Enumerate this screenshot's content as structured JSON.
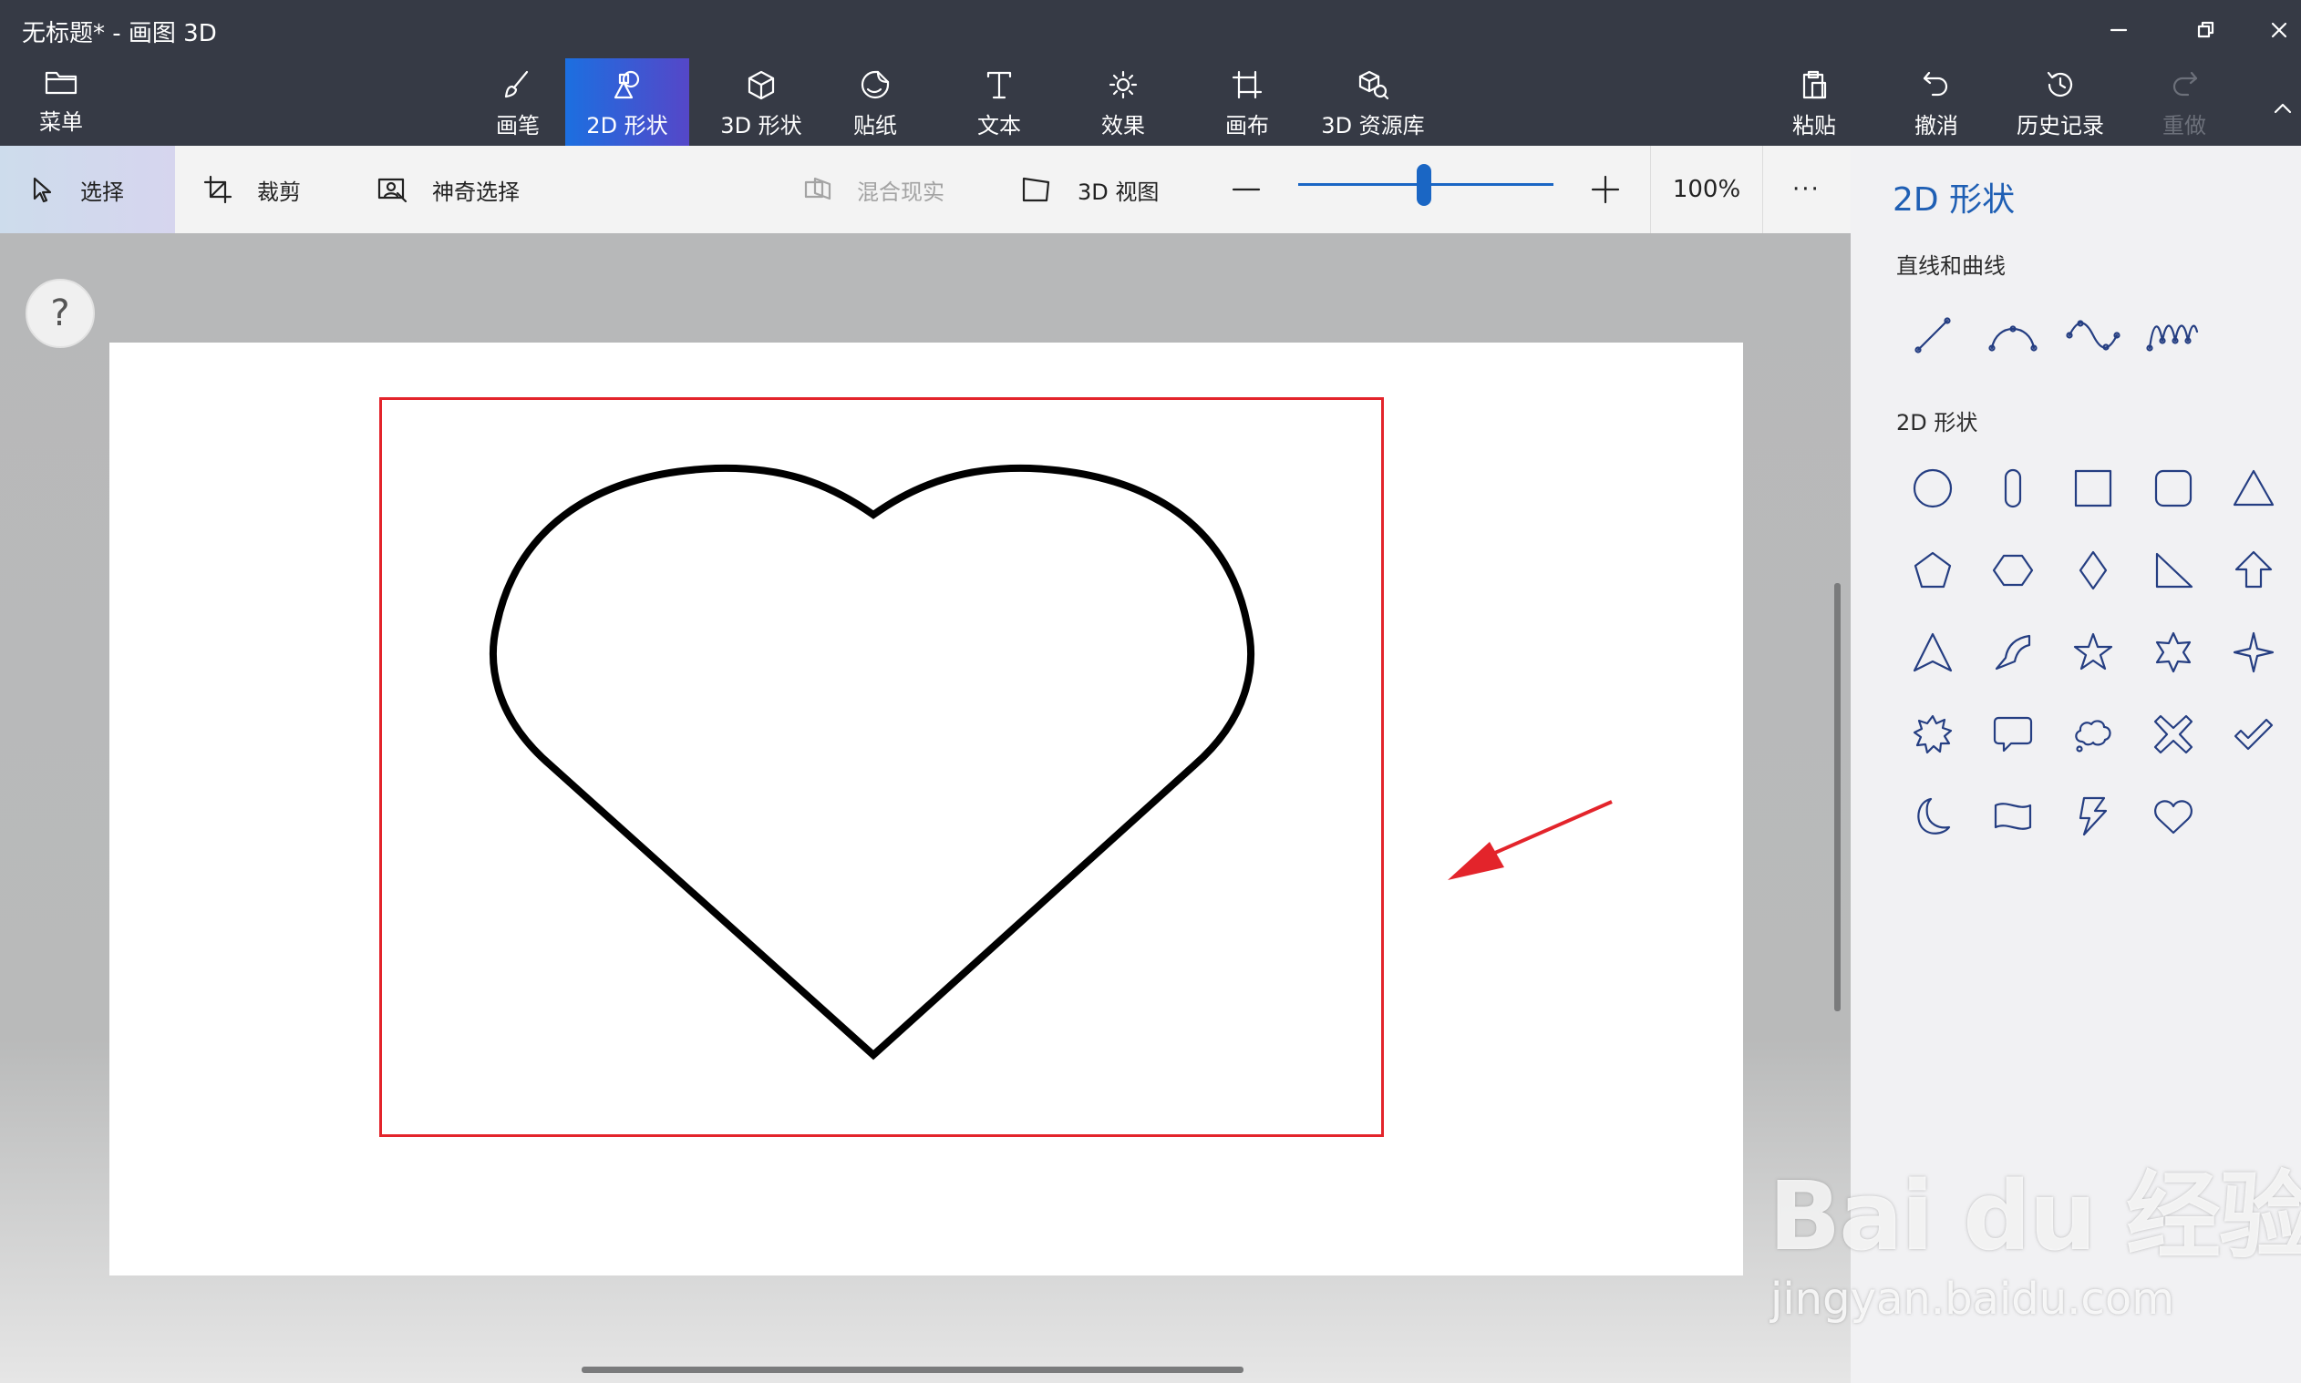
{
  "window": {
    "title": "无标题* - 画图 3D"
  },
  "ribbon": {
    "menu_label": "菜单",
    "tabs": [
      {
        "label": "画笔",
        "icon": "brush-icon"
      },
      {
        "label": "2D 形状",
        "icon": "2d-shapes-icon",
        "active": true
      },
      {
        "label": "3D 形状",
        "icon": "3d-shapes-icon"
      },
      {
        "label": "贴纸",
        "icon": "sticker-icon"
      },
      {
        "label": "文本",
        "icon": "text-icon"
      },
      {
        "label": "效果",
        "icon": "effects-icon"
      },
      {
        "label": "画布",
        "icon": "canvas-icon"
      },
      {
        "label": "3D 资源库",
        "icon": "3d-library-icon"
      }
    ],
    "actions": [
      {
        "label": "粘贴",
        "icon": "paste-icon"
      },
      {
        "label": "撤消",
        "icon": "undo-icon"
      },
      {
        "label": "历史记录",
        "icon": "history-icon"
      },
      {
        "label": "重做",
        "icon": "redo-icon",
        "disabled": true
      }
    ]
  },
  "toolbar": {
    "select_label": "选择",
    "crop_label": "裁剪",
    "magic_select_label": "神奇选择",
    "mixed_reality_label": "混合现实",
    "view3d_label": "3D 视图",
    "zoom_percent": "100%",
    "zoom_level": 0.5,
    "more_label": "···"
  },
  "panel": {
    "title": "2D 形状",
    "lines_section": "直线和曲线",
    "shapes_section": "2D 形状",
    "line_tools": [
      "line-icon",
      "curve-icon",
      "s-curve-icon",
      "wave-curve-icon"
    ],
    "shape_tools": [
      "circle-icon",
      "rounded-capsule-icon",
      "square-icon",
      "rounded-square-icon",
      "triangle-icon",
      "pentagon-icon",
      "hexagon-icon",
      "diamond-icon",
      "right-triangle-icon",
      "arrow-up-icon",
      "arrowhead-icon",
      "quarter-circle-icon",
      "star5-icon",
      "star6-icon",
      "star4-icon",
      "burst-icon",
      "speech-bubble-icon",
      "thought-bubble-icon",
      "cross-icon",
      "checkmark-icon",
      "moon-icon",
      "banner-icon",
      "lightning-icon",
      "heart-icon"
    ]
  },
  "canvas": {
    "help_label": "?",
    "shape": "heart-icon",
    "selection_color": "#e3242b",
    "annotation_arrow_color": "#e3242b"
  },
  "watermark": {
    "logo_text": "Bai du 经验",
    "url": "jingyan.baidu.com"
  },
  "colors": {
    "ribbon_bg": "#363a45",
    "active_tab_start": "#1c6fe0",
    "active_tab_end": "#5547c8",
    "accent": "#1a66c4",
    "panel_icon": "#253e82"
  }
}
